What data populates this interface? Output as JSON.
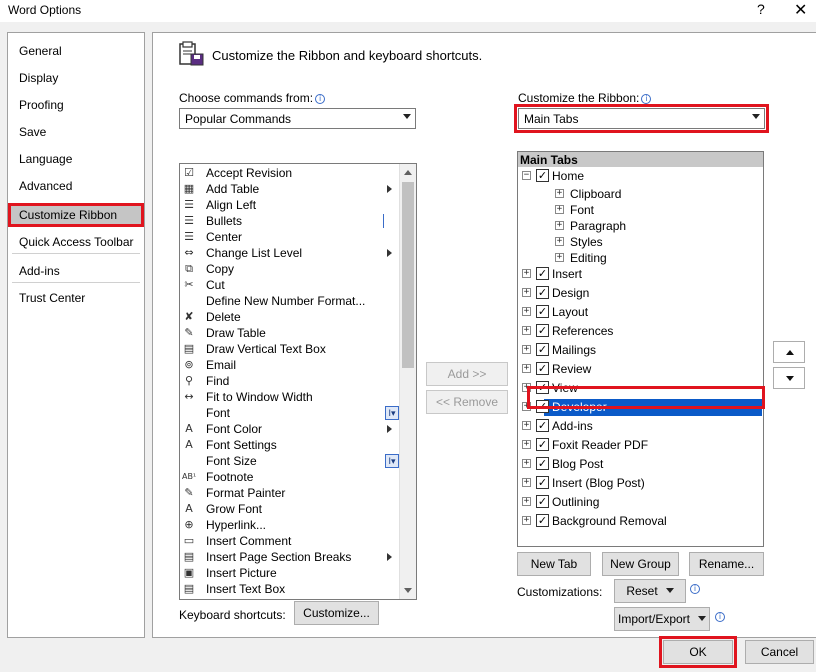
{
  "window": {
    "title": "Word Options",
    "help": "?",
    "close": "✕"
  },
  "nav": {
    "items": [
      {
        "label": "General"
      },
      {
        "label": "Display"
      },
      {
        "label": "Proofing"
      },
      {
        "label": "Save"
      },
      {
        "label": "Language"
      },
      {
        "label": "Advanced"
      },
      {
        "label": "Customize Ribbon",
        "selected": true
      },
      {
        "label": "Quick Access Toolbar"
      },
      {
        "label": "Add-ins"
      },
      {
        "label": "Trust Center"
      }
    ]
  },
  "header": {
    "title": "Customize the Ribbon and keyboard shortcuts."
  },
  "commands": {
    "label": "Choose commands from:",
    "selected": "Popular Commands",
    "items": [
      {
        "label": "Accept Revision",
        "icon": "accept-revision-icon",
        "glyph": "☑"
      },
      {
        "label": "Add Table",
        "icon": "table-icon",
        "glyph": "▦",
        "submenu": true
      },
      {
        "label": "Align Left",
        "icon": "align-left-icon",
        "glyph": "☰"
      },
      {
        "label": "Bullets",
        "icon": "bullets-icon",
        "glyph": "☰",
        "inline_box": true
      },
      {
        "label": "Center",
        "icon": "align-center-icon",
        "glyph": "☰"
      },
      {
        "label": "Change List Level",
        "icon": "list-level-icon",
        "glyph": "⇔",
        "submenu": true
      },
      {
        "label": "Copy",
        "icon": "copy-icon",
        "glyph": "⧉"
      },
      {
        "label": "Cut",
        "icon": "scissors-icon",
        "glyph": "✂"
      },
      {
        "label": "Define New Number Format...",
        "icon": "",
        "glyph": ""
      },
      {
        "label": "Delete",
        "icon": "delete-icon",
        "glyph": "✘"
      },
      {
        "label": "Draw Table",
        "icon": "draw-table-icon",
        "glyph": "✎"
      },
      {
        "label": "Draw Vertical Text Box",
        "icon": "text-box-icon",
        "glyph": "▤"
      },
      {
        "label": "Email",
        "icon": "attach-icon",
        "glyph": "⊚"
      },
      {
        "label": "Find",
        "icon": "find-icon",
        "glyph": "⚲"
      },
      {
        "label": "Fit to Window Width",
        "icon": "fit-width-icon",
        "glyph": "↔"
      },
      {
        "label": "Font",
        "icon": "",
        "glyph": "",
        "ibox": "I▾"
      },
      {
        "label": "Font Color",
        "icon": "font-color-icon",
        "glyph": "A",
        "submenu": true
      },
      {
        "label": "Font Settings",
        "icon": "font-settings-icon",
        "glyph": "A"
      },
      {
        "label": "Font Size",
        "icon": "",
        "glyph": "",
        "ibox": "I▾"
      },
      {
        "label": "Footnote",
        "icon": "footnote-icon",
        "glyph": "AB¹"
      },
      {
        "label": "Format Painter",
        "icon": "format-painter-icon",
        "glyph": "✎"
      },
      {
        "label": "Grow Font",
        "icon": "grow-font-icon",
        "glyph": "A"
      },
      {
        "label": "Hyperlink...",
        "icon": "hyperlink-icon",
        "glyph": "⊕"
      },
      {
        "label": "Insert Comment",
        "icon": "comment-icon",
        "glyph": "▭"
      },
      {
        "label": "Insert Page  Section Breaks",
        "icon": "page-break-icon",
        "glyph": "▤",
        "submenu": true
      },
      {
        "label": "Insert Picture",
        "icon": "picture-icon",
        "glyph": "▣"
      },
      {
        "label": "Insert Text Box",
        "icon": "text-box-icon",
        "glyph": "▤"
      }
    ]
  },
  "middle": {
    "add": "Add >>",
    "remove": "<< Remove"
  },
  "ribbon": {
    "label": "Customize the Ribbon:",
    "selected": "Main Tabs",
    "tree_header": "Main Tabs",
    "items": [
      {
        "label": "Home",
        "level": 0,
        "exp": "−",
        "check": true
      },
      {
        "label": "Clipboard",
        "level": 1,
        "exp": "+",
        "check": false
      },
      {
        "label": "Font",
        "level": 1,
        "exp": "+",
        "check": false
      },
      {
        "label": "Paragraph",
        "level": 1,
        "exp": "+",
        "check": false
      },
      {
        "label": "Styles",
        "level": 1,
        "exp": "+",
        "check": false
      },
      {
        "label": "Editing",
        "level": 1,
        "exp": "+",
        "check": false
      },
      {
        "label": "Insert",
        "level": 0,
        "exp": "+",
        "check": true
      },
      {
        "label": "Design",
        "level": 0,
        "exp": "+",
        "check": true
      },
      {
        "label": "Layout",
        "level": 0,
        "exp": "+",
        "check": true
      },
      {
        "label": "References",
        "level": 0,
        "exp": "+",
        "check": true
      },
      {
        "label": "Mailings",
        "level": 0,
        "exp": "+",
        "check": true
      },
      {
        "label": "Review",
        "level": 0,
        "exp": "+",
        "check": true
      },
      {
        "label": "View",
        "level": 0,
        "exp": "+",
        "check": true
      },
      {
        "label": "Developer",
        "level": 0,
        "exp": "+",
        "check": true,
        "selected": true
      },
      {
        "label": "Add-ins",
        "level": 0,
        "exp": "+",
        "check": true
      },
      {
        "label": "Foxit Reader PDF",
        "level": 0,
        "exp": "+",
        "check": true
      },
      {
        "label": "Blog Post",
        "level": 0,
        "exp": "+",
        "check": true
      },
      {
        "label": "Insert (Blog Post)",
        "level": 0,
        "exp": "+",
        "check": true
      },
      {
        "label": "Outlining",
        "level": 0,
        "exp": "+",
        "check": true
      },
      {
        "label": "Background Removal",
        "level": 0,
        "exp": "+",
        "check": true
      }
    ],
    "new_tab": "New Tab",
    "new_group": "New Group",
    "rename": "Rename...",
    "customizations_label": "Customizations:",
    "reset": "Reset",
    "import_export": "Import/Export"
  },
  "keyboard": {
    "label": "Keyboard shortcuts:",
    "customize": "Customize..."
  },
  "footer": {
    "ok": "OK",
    "cancel": "Cancel"
  },
  "colors": {
    "highlight_red": "#e0141e",
    "selection_blue": "#0b5ac8"
  }
}
